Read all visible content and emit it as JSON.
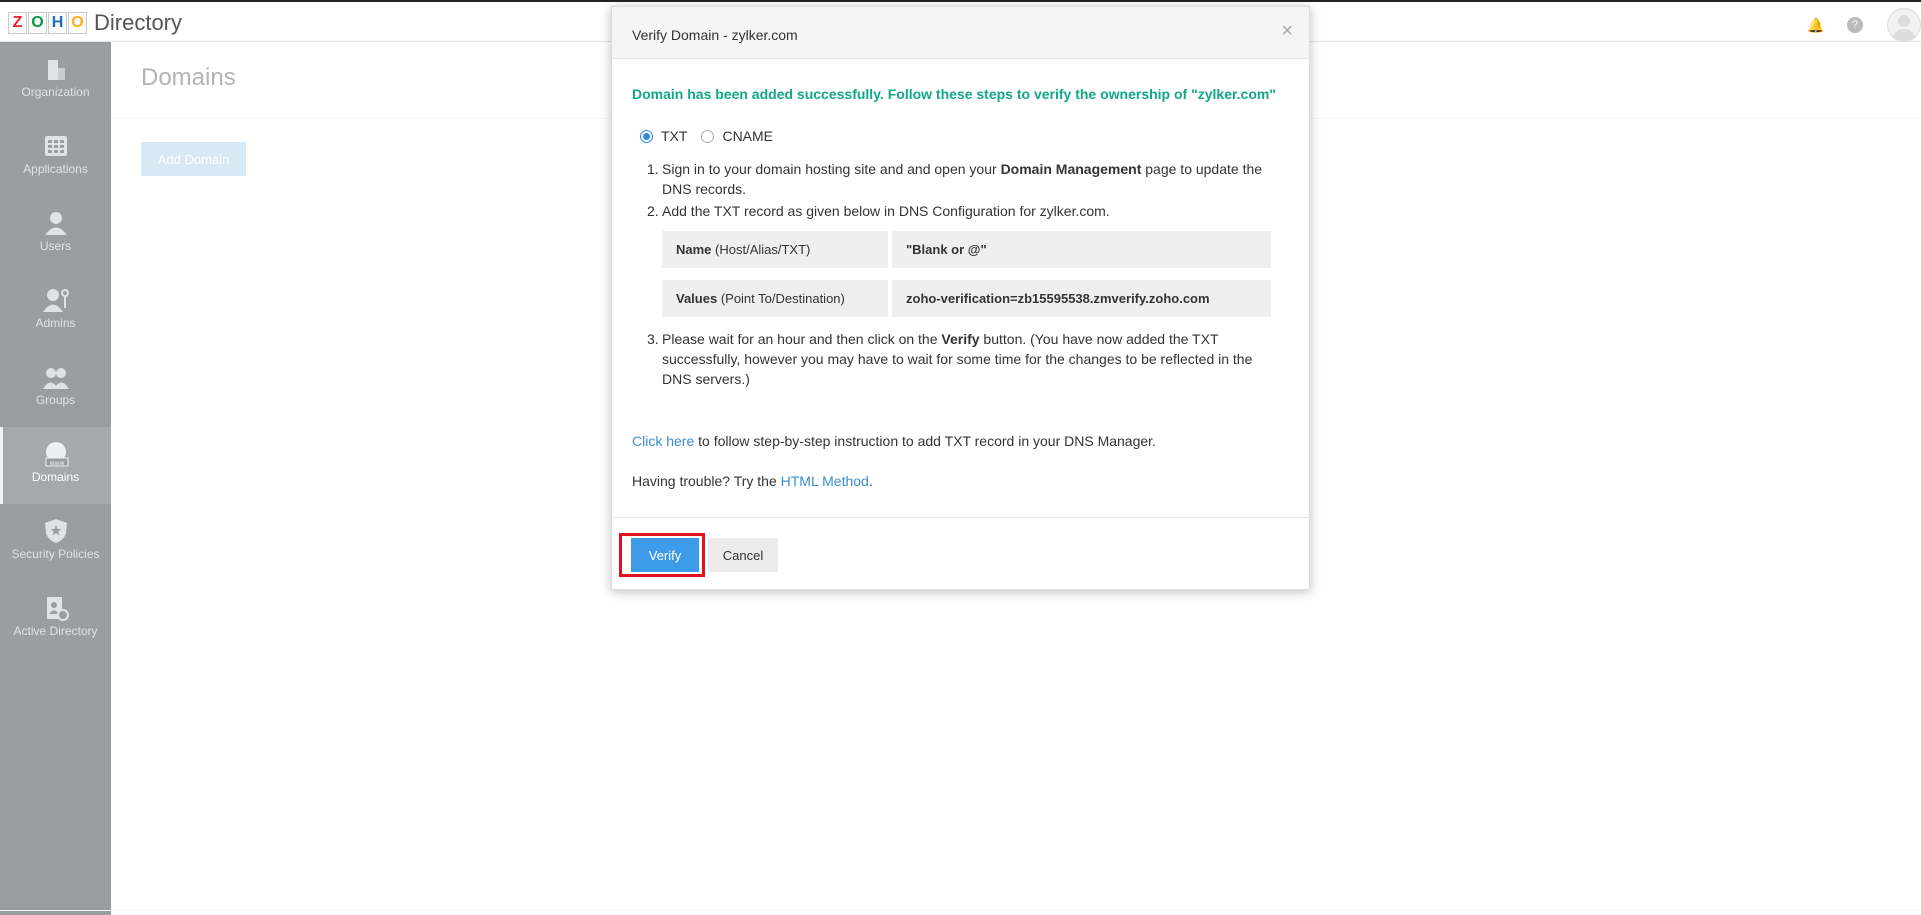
{
  "app": {
    "logo_letters": [
      "Z",
      "O",
      "H",
      "O"
    ],
    "logo_colors": [
      "#e42527",
      "#089949",
      "#226db4",
      "#f9b21d"
    ],
    "title": "Directory"
  },
  "topbar": {
    "icons": [
      "bell-icon",
      "help-icon",
      "avatar"
    ]
  },
  "sidebar": {
    "items": [
      {
        "label": "Organization",
        "icon": "organization-icon"
      },
      {
        "label": "Applications",
        "icon": "applications-grid-icon"
      },
      {
        "label": "Users",
        "icon": "user-icon"
      },
      {
        "label": "Admins",
        "icon": "admin-key-icon"
      },
      {
        "label": "Groups",
        "icon": "groups-icon"
      },
      {
        "label": "Domains",
        "icon": "globe-www-icon",
        "active": true
      },
      {
        "label": "Security Policies",
        "icon": "shield-star-icon"
      },
      {
        "label": "Active Directory",
        "icon": "active-directory-icon"
      }
    ]
  },
  "main": {
    "title": "Domains",
    "add_button": "Add Domain"
  },
  "modal": {
    "title": "Verify Domain - zylker.com",
    "close": "×",
    "success": "Domain has been added successfully. Follow these steps to verify the ownership of \"zylker.com\"",
    "options": [
      {
        "label": "TXT",
        "checked": true
      },
      {
        "label": "CNAME",
        "checked": false
      }
    ],
    "step1": {
      "num": "1.",
      "pre": "Sign in to your domain hosting site and and open your ",
      "bold": "Domain Management",
      "post": " page to update the DNS records."
    },
    "step2": {
      "num": "2.",
      "text": "Add the TXT record as given below in DNS Configuration for zylker.com."
    },
    "dns": [
      {
        "key_bold": "Name",
        "key_rest": " (Host/Alias/TXT)",
        "value": "\"Blank or @\""
      },
      {
        "key_bold": "Values",
        "key_rest": " (Point To/Destination)",
        "value": "zoho-verification=zb15595538.zmverify.zoho.com"
      }
    ],
    "step3": {
      "num": "3.",
      "pre": "Please wait for an hour and then click on the ",
      "bold": "Verify",
      "post": " button. (You have now added the TXT successfully, however you may have to wait for some time for the changes to be reflected in the DNS servers.)"
    },
    "click_here": {
      "link": "Click here",
      "text": " to follow step-by-step instruction to add TXT record in your DNS Manager."
    },
    "trouble": {
      "pre": "Having trouble? Try the ",
      "link": "HTML Method",
      "post": "."
    },
    "verify_label": "Verify",
    "cancel_label": "Cancel",
    "highlight_color": "#e0141e",
    "accent_color": "#3d9be9",
    "success_color": "#12a886"
  }
}
